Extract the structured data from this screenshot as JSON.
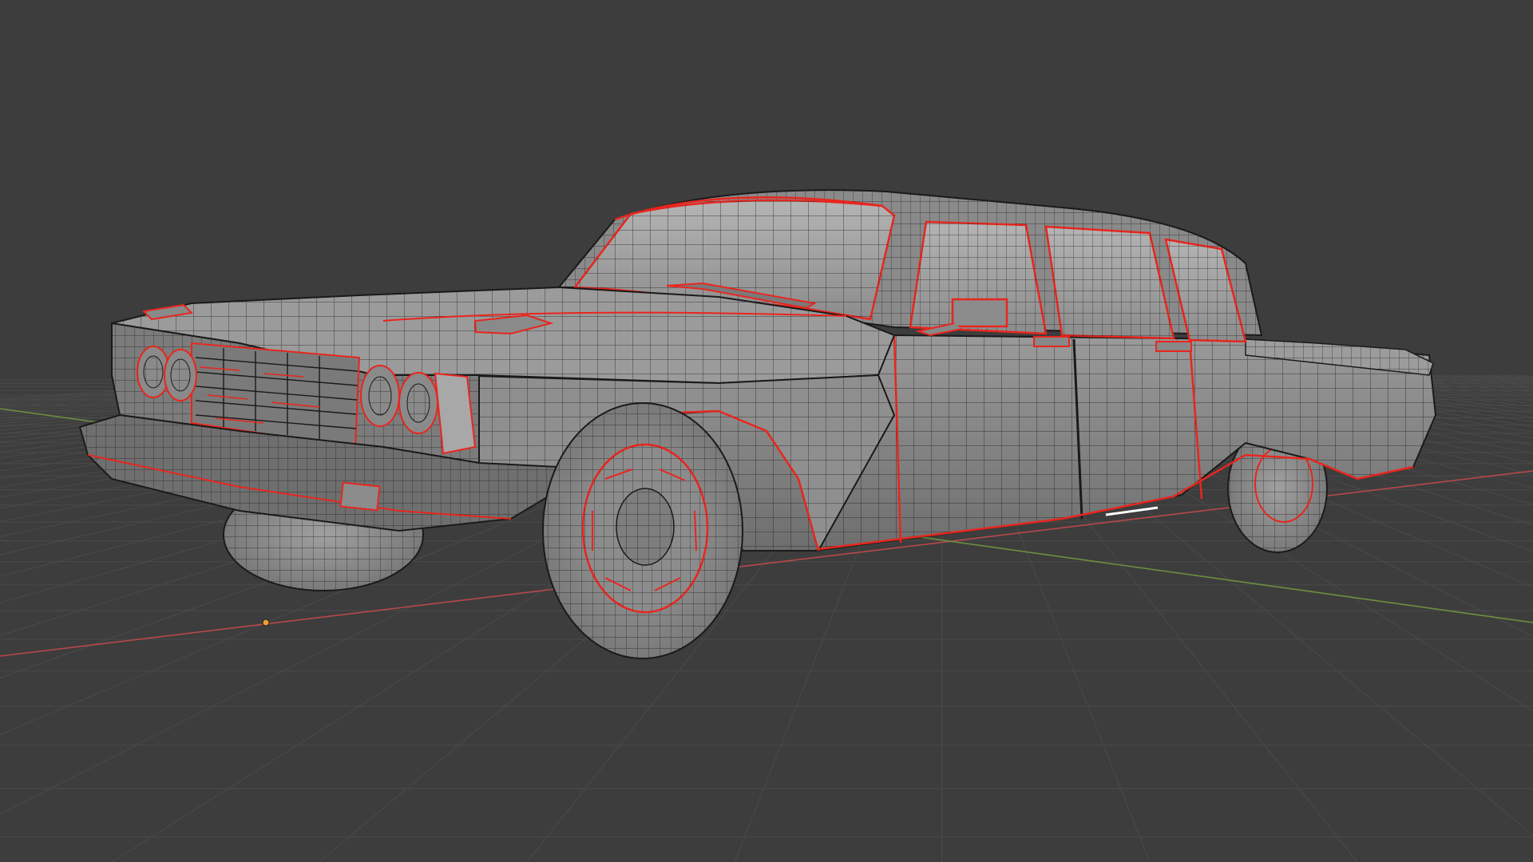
{
  "viewport": {
    "editor": "3D Viewport",
    "view": "perspective",
    "shading": "solid",
    "overlays": {
      "wireframe": true,
      "floor_grid": true,
      "axis_x": true,
      "axis_y": true
    },
    "mode": "edit"
  },
  "scene": {
    "object": {
      "kind": "car-model",
      "icon": "car-mesh",
      "selected_edges_color": "#e8261e",
      "wire_color": "#1a1a1a"
    },
    "origin_point": {
      "icon": "object-origin-dot",
      "color": "#f0a030"
    }
  },
  "colors": {
    "background": "#3d3d3d",
    "grid_line": "#4a4a4a",
    "axis_x": "#b8484c",
    "axis_y": "#6c9040",
    "body_fill": "#8e8e8e",
    "glass_fill": "#a6a6a6",
    "tire_fill": "#969696",
    "seam": "#e8261e"
  }
}
